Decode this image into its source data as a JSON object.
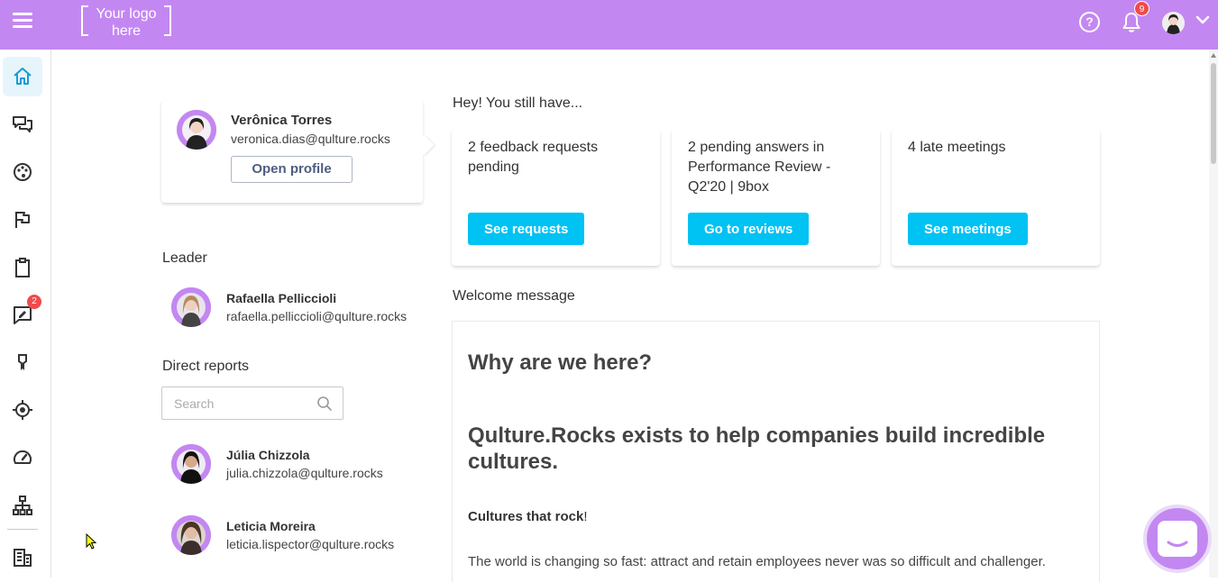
{
  "topbar": {
    "logo_text": "Your logo here",
    "notification_count": "9",
    "colors": {
      "brand": "#c387f2",
      "accent": "#00c2f3",
      "badge": "#f04b4b"
    }
  },
  "sidebar": {
    "items": [
      {
        "icon": "home-icon",
        "active": true
      },
      {
        "icon": "chat-icon"
      },
      {
        "icon": "palette-icon"
      },
      {
        "icon": "flag-icon"
      },
      {
        "icon": "clipboard-icon"
      },
      {
        "icon": "feedback-icon",
        "badge": "2"
      },
      {
        "icon": "award-icon"
      },
      {
        "icon": "target-icon"
      },
      {
        "icon": "speedometer-icon"
      },
      {
        "icon": "org-chart-icon"
      },
      {
        "icon": "building-icon"
      }
    ]
  },
  "profile": {
    "name": "Verônica Torres",
    "email": "veronica.dias@qulture.rocks",
    "open_profile_label": "Open profile"
  },
  "leader": {
    "title": "Leader",
    "name": "Rafaella Pelliccioli",
    "email": "rafaella.pelliccioli@qulture.rocks"
  },
  "direct_reports": {
    "title": "Direct reports",
    "search_placeholder": "Search",
    "people": [
      {
        "name": "Júlia Chizzola",
        "email": "julia.chizzola@qulture.rocks"
      },
      {
        "name": "Leticia Moreira",
        "email": "leticia.lispector@qulture.rocks"
      }
    ]
  },
  "pending": {
    "title": "Hey! You still have...",
    "cards": [
      {
        "text": "2 feedback requests pending",
        "button": "See requests"
      },
      {
        "text": "2 pending answers in Performance Review - Q2'20 | 9box",
        "button": "Go to reviews"
      },
      {
        "text": "4 late meetings",
        "button": "See meetings"
      }
    ]
  },
  "welcome": {
    "title": "Welcome message",
    "heading1": "Why are we here?",
    "heading2": "Qulture.Rocks exists to help companies build incredible cultures.",
    "bold_text": "Cultures that rock",
    "exclamation": "!",
    "paragraph": "The world is changing so fast: attract and retain employees never was so difficult and challenger."
  }
}
